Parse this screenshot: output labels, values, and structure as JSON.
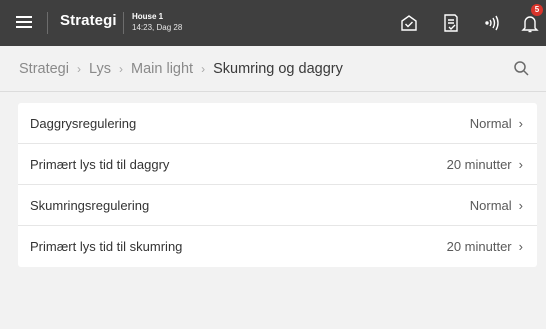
{
  "topbar": {
    "title": "Strategi",
    "house_name": "House 1",
    "house_time": "14:23, Dag 28",
    "notification_count": "5",
    "bg_color": "#3f3f3f",
    "badge_color": "#d9342b"
  },
  "breadcrumb": {
    "items": [
      "Strategi",
      "Lys",
      "Main light"
    ],
    "current": "Skumring og daggry"
  },
  "settings": [
    {
      "label": "Daggrysregulering",
      "value": "Normal"
    },
    {
      "label": "Primært lys tid til daggry",
      "value": "20 minutter"
    },
    {
      "label": "Skumringsregulering",
      "value": "Normal"
    },
    {
      "label": "Primært lys tid til skumring",
      "value": "20 minutter"
    }
  ],
  "icons": {
    "menu": "hamburger-menu-icon",
    "house": "house-status-icon",
    "report": "report-document-icon",
    "wireless": "wireless-signal-icon",
    "notifications": "bell-icon",
    "search": "search-icon",
    "chevron": "chevron-right-icon"
  }
}
